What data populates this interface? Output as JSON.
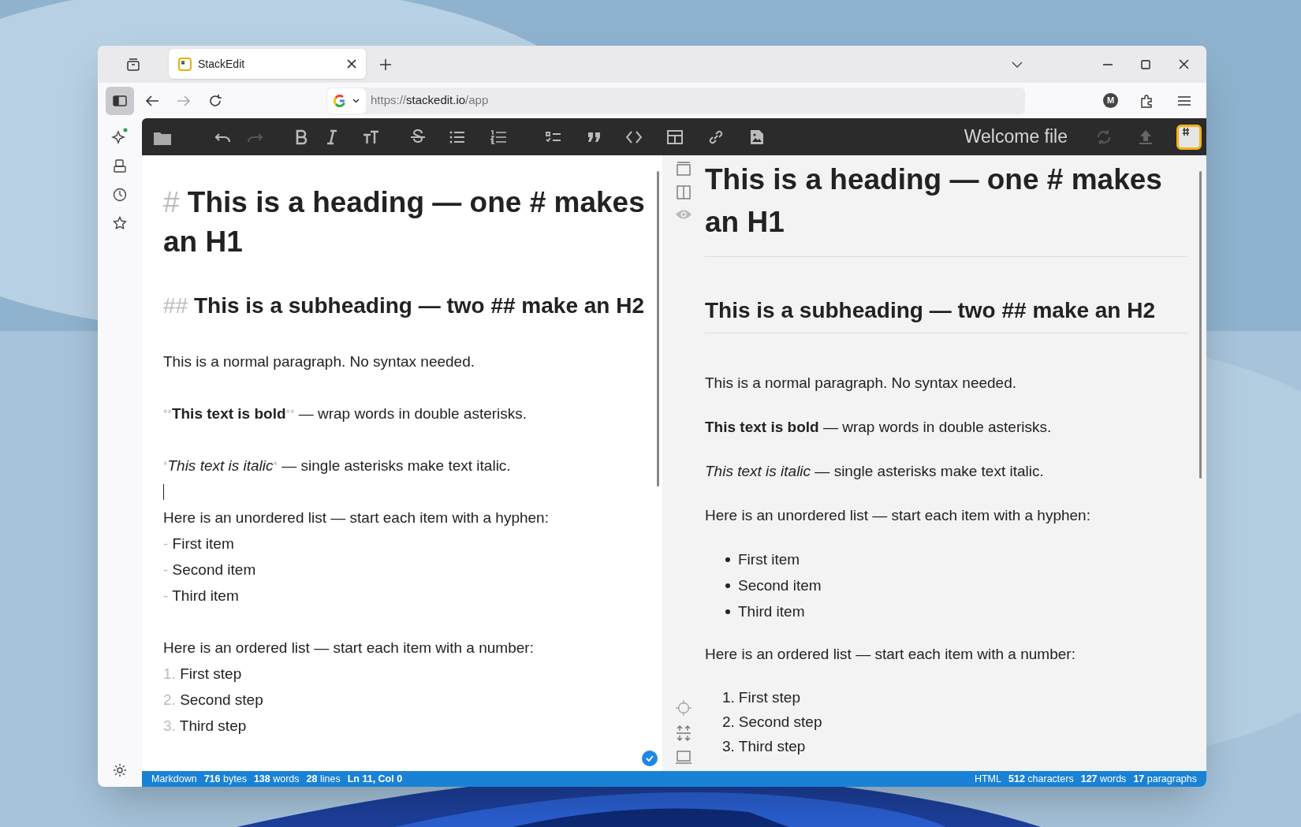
{
  "browser": {
    "tab_title": "StackEdit",
    "url_scheme": "https://",
    "url_host": "stackedit.io",
    "url_path": "/app",
    "profile": "M"
  },
  "toolbar": {
    "file_title": "Welcome file"
  },
  "editor": {
    "lines": [
      {
        "kind": "h1",
        "marker": "#",
        "text": "This is a heading — one # makes an H1"
      },
      {
        "kind": "h2",
        "marker": "##",
        "text": "This is a subheading — two ## make an H2"
      },
      {
        "kind": "p",
        "text": "This is a normal paragraph. No syntax needed."
      },
      {
        "kind": "blank"
      },
      {
        "kind": "bold",
        "marker": "**",
        "text": "This text is bold",
        "rest": " — wrap words in double asterisks."
      },
      {
        "kind": "blank"
      },
      {
        "kind": "italic",
        "marker": "*",
        "text": "This text is italic",
        "rest": " — single asterisks make text italic."
      },
      {
        "kind": "cursor"
      },
      {
        "kind": "p",
        "text": "Here is an unordered list — start each item with a hyphen:"
      },
      {
        "kind": "li",
        "marker": "-",
        "text": "First item"
      },
      {
        "kind": "li",
        "marker": "-",
        "text": "Second item"
      },
      {
        "kind": "li",
        "marker": "-",
        "text": "Third item"
      },
      {
        "kind": "blank"
      },
      {
        "kind": "p",
        "text": "Here is an ordered list — start each item with a number:"
      },
      {
        "kind": "li",
        "marker": "1.",
        "text": "First step"
      },
      {
        "kind": "li",
        "marker": "2.",
        "text": "Second step"
      },
      {
        "kind": "li",
        "marker": "3.",
        "text": "Third step"
      }
    ]
  },
  "preview": {
    "blocks": [
      {
        "kind": "h1",
        "text": "This is a heading — one # makes an H1"
      },
      {
        "kind": "h2",
        "text": "This is a subheading — two ## make an H2"
      },
      {
        "kind": "p",
        "text": "This is a normal paragraph. No syntax needed."
      },
      {
        "kind": "p",
        "text": "**This text is bold** — wrap words in double asterisks."
      },
      {
        "kind": "p",
        "text": "*This text is italic* — single asterisks make text italic."
      },
      {
        "kind": "p",
        "text": "Here is an unordered list — start each item with a hyphen:"
      },
      {
        "kind": "ul",
        "items": [
          "First item",
          "Second item",
          "Third item"
        ]
      },
      {
        "kind": "p",
        "text": "Here is an ordered list — start each item with a number:"
      },
      {
        "kind": "ol",
        "items": [
          {
            "number": "1.",
            "text": "First step"
          },
          {
            "number": "2.",
            "text": "Second step"
          },
          {
            "number": "3.",
            "text": "Third step"
          }
        ]
      }
    ]
  },
  "status_left": [
    {
      "kind": "label",
      "text": "Markdown"
    },
    {
      "kind": "stat",
      "value": "716",
      "unit": "bytes"
    },
    {
      "kind": "stat",
      "value": "138",
      "unit": "words"
    },
    {
      "kind": "stat",
      "value": "28",
      "unit": "lines"
    },
    {
      "kind": "strong",
      "text": "Ln 11, Col 0"
    }
  ],
  "status_right": [
    {
      "kind": "label",
      "text": "HTML"
    },
    {
      "kind": "stat",
      "value": "512",
      "unit": "characters"
    },
    {
      "kind": "stat",
      "value": "127",
      "unit": "words"
    },
    {
      "kind": "stat",
      "value": "17",
      "unit": "paragraphs"
    }
  ]
}
